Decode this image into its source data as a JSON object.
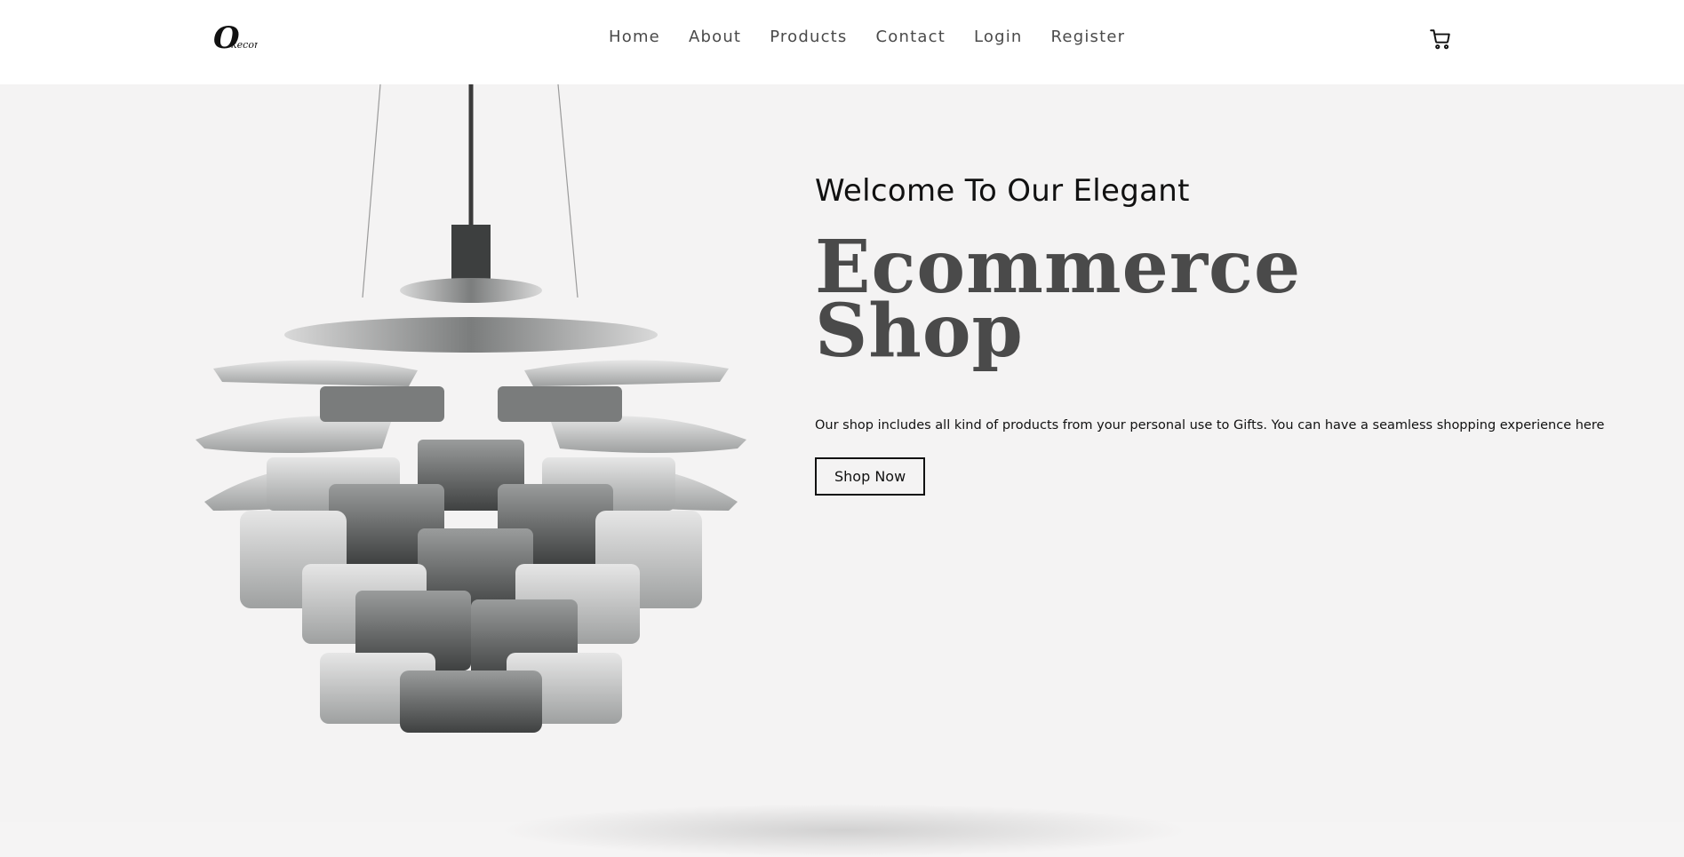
{
  "header": {
    "logo_text": "Okecore",
    "nav": [
      {
        "label": "Home"
      },
      {
        "label": "About"
      },
      {
        "label": "Products"
      },
      {
        "label": "Contact"
      },
      {
        "label": "Login"
      },
      {
        "label": "Register"
      }
    ],
    "cart_icon": "shopping-cart-icon"
  },
  "hero": {
    "welcome": "Welcome To Our Elegant",
    "headline_line1": "Ecommerce",
    "headline_line2": "Shop",
    "description": "Our shop includes all kind of products from your personal use to Gifts. You can have a seamless shopping experience here",
    "cta_label": "Shop Now",
    "image": "pendant-lamp-image"
  },
  "colors": {
    "header_bg": "#ffffff",
    "hero_bg": "#f4f3f3",
    "headline": "#4a4a4a",
    "text": "#111111"
  }
}
